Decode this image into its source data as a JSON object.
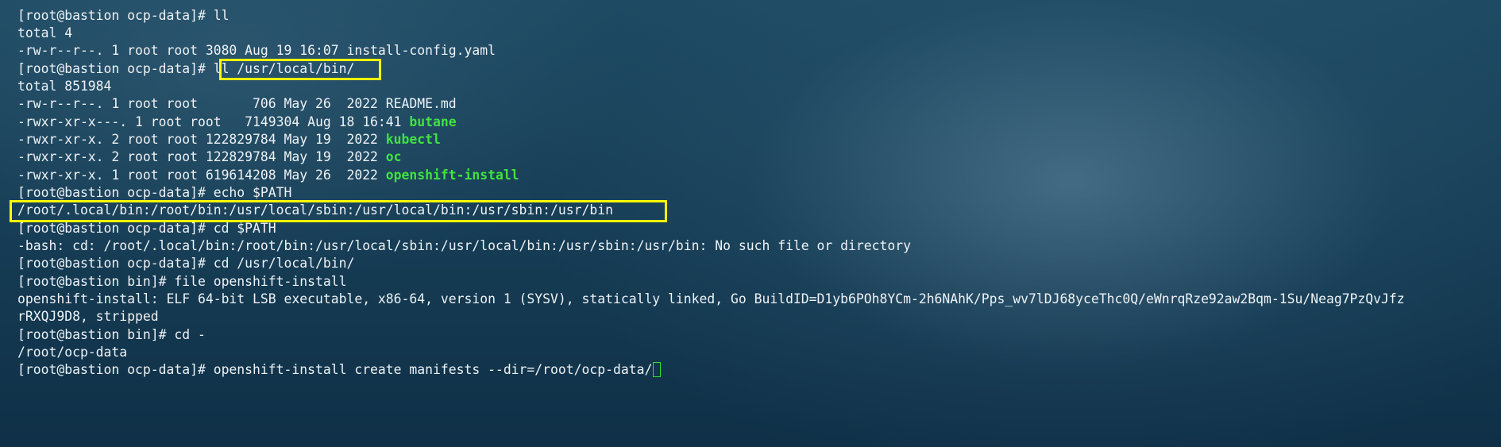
{
  "terminal": {
    "lines": [
      {
        "text": "[root@bastion ocp-data]# ll"
      },
      {
        "text": "total 4"
      },
      {
        "text": "-rw-r--r--. 1 root root 3080 Aug 19 16:07 install-config.yaml"
      },
      {
        "prompt": "[root@bastion ocp-data]# ",
        "command": "ll /usr/local/bin/"
      },
      {
        "text": "total 851984"
      },
      {
        "text": "-rw-r--r--. 1 root root       706 May 26  2022 README.md"
      },
      {
        "prefix": "-rwxr-xr-x---. 1 root root   7149304 Aug 18 16:41 ",
        "name": "butane"
      },
      {
        "prefix": "-rwxr-xr-x. 2 root root 122829784 May 19  2022 ",
        "name": "kubectl"
      },
      {
        "prefix": "-rwxr-xr-x. 2 root root 122829784 May 19  2022 ",
        "name": "oc"
      },
      {
        "prefix": "-rwxr-xr-x. 1 root root 619614208 May 26  2022 ",
        "name": "openshift-install"
      },
      {
        "text": "[root@bastion ocp-data]# echo $PATH"
      },
      {
        "text": "/root/.local/bin:/root/bin:/usr/local/sbin:/usr/local/bin:/usr/sbin:/usr/bin"
      },
      {
        "text": "[root@bastion ocp-data]# cd $PATH"
      },
      {
        "text": "-bash: cd: /root/.local/bin:/root/bin:/usr/local/sbin:/usr/local/bin:/usr/sbin:/usr/bin: No such file or directory"
      },
      {
        "text": "[root@bastion ocp-data]# cd /usr/local/bin/"
      },
      {
        "text": "[root@bastion bin]# file openshift-install"
      },
      {
        "text": "openshift-install: ELF 64-bit LSB executable, x86-64, version 1 (SYSV), statically linked, Go BuildID=D1yb6POh8YCm-2h6NAhK/Pps_wv7lDJ68yceThc0Q/eWnrqRze92aw2Bqm-1Su/Neag7PzQvJfz"
      },
      {
        "text": "rRXQJ9D8, stripped"
      },
      {
        "text": "[root@bastion bin]# cd -"
      },
      {
        "text": "/root/ocp-data"
      },
      {
        "text": "[root@bastion ocp-data]# openshift-install create manifests --dir=/root/ocp-data/"
      }
    ]
  },
  "colors": {
    "text": "#eef2f5",
    "executable": "#3fe33f",
    "highlight_box": "#ffff00",
    "cursor": "#2fe02f"
  }
}
